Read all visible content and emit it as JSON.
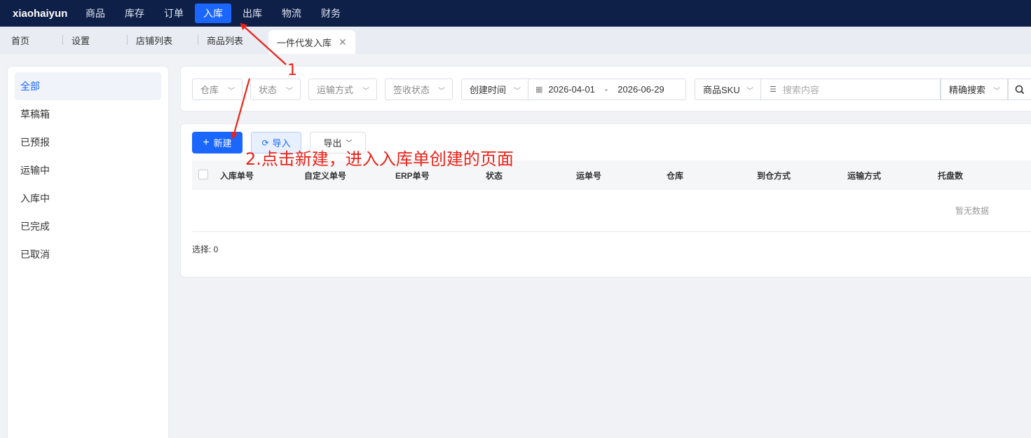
{
  "topnav": {
    "brand": "xiaohaiyun",
    "items": [
      {
        "label": "商品"
      },
      {
        "label": "库存"
      },
      {
        "label": "订单"
      },
      {
        "label": "入库"
      },
      {
        "label": "出库"
      },
      {
        "label": "物流"
      },
      {
        "label": "财务"
      }
    ],
    "active": "入库"
  },
  "tabs": [
    {
      "label": "首页"
    },
    {
      "label": "设置"
    },
    {
      "label": "店铺列表"
    },
    {
      "label": "商品列表"
    },
    {
      "label": "一件代发入库"
    }
  ],
  "sidebar": {
    "items": [
      {
        "label": "全部"
      },
      {
        "label": "草稿箱"
      },
      {
        "label": "已预报"
      },
      {
        "label": "运输中"
      },
      {
        "label": "入库中"
      },
      {
        "label": "已完成"
      },
      {
        "label": "已取消"
      }
    ]
  },
  "filters": {
    "warehouse": "仓库",
    "status": "状态",
    "transport": "运输方式",
    "sign_status": "签收状态",
    "date_type": "创建时间",
    "date_start": "2026-04-01",
    "date_sep": "-",
    "date_end": "2026-06-29",
    "search_field": "商品SKU",
    "search_placeholder": "搜索内容",
    "search_mode": "精确搜索"
  },
  "toolbar": {
    "new_label": "新建",
    "import_label": "导入",
    "export_label": "导出"
  },
  "table": {
    "columns": [
      "入库单号",
      "自定义单号",
      "ERP单号",
      "状态",
      "运单号",
      "仓库",
      "到仓方式",
      "运输方式",
      "托盘数"
    ],
    "empty_text": "暂无数据",
    "selected_text": "选择: 0"
  },
  "annotations": {
    "step1": "1",
    "step2": "2.点击新建，进入入库单创建的页面",
    "color": "#e8231a"
  },
  "colors": {
    "primary": "#1a66ff",
    "nav_bg": "#0e1f48"
  }
}
